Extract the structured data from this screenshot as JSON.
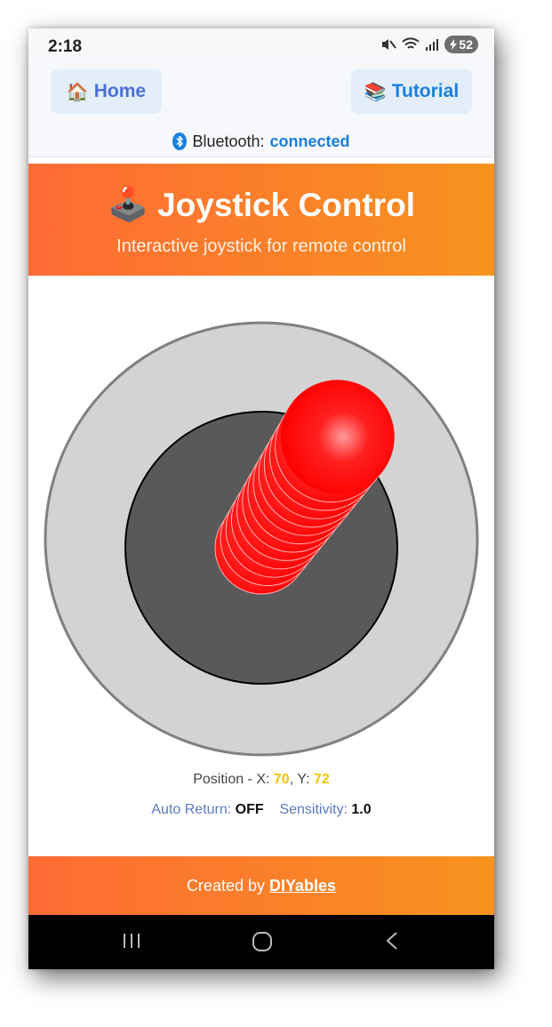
{
  "status_bar": {
    "time": "2:18",
    "battery": "52"
  },
  "nav": {
    "home_icon": "house-emoji",
    "home_label": "Home",
    "tutorial_icon": "books-emoji",
    "tutorial_label": "Tutorial"
  },
  "bluetooth": {
    "label": "Bluetooth:",
    "status": "connected"
  },
  "header": {
    "icon": "joystick-emoji",
    "title": "Joystick Control",
    "subtitle": "Interactive joystick for remote control"
  },
  "joystick": {
    "x": 70,
    "y": 72,
    "knob_color": "#ff0000",
    "ring_color": "#d3d3d3",
    "base_color": "#5a5a5a"
  },
  "readout": {
    "position_label": "Position - X:",
    "x_value": "70",
    "y_label": ", Y:",
    "y_value": "72",
    "auto_return_label": "Auto Return:",
    "auto_return_value": "OFF",
    "sensitivity_label": "Sensitivity:",
    "sensitivity_value": "1.0"
  },
  "footer": {
    "prefix": "Created by",
    "link": "DIYables"
  },
  "colors": {
    "accent_start": "#ff6b35",
    "accent_end": "#f7931e",
    "link_blue": "#1a7fe0"
  }
}
